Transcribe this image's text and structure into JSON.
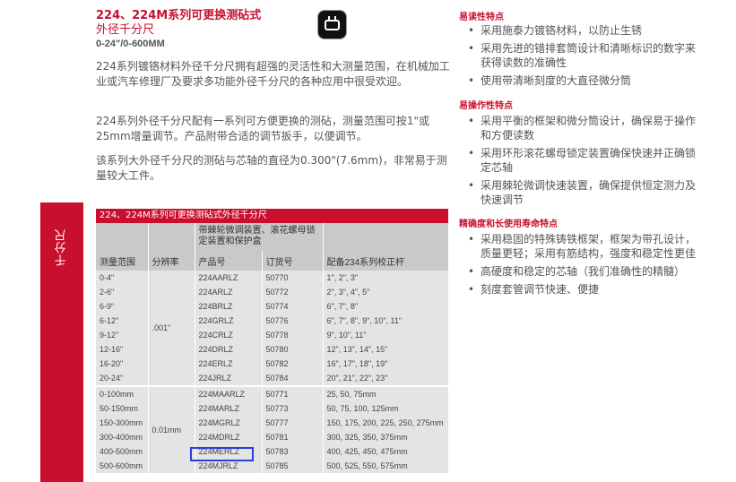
{
  "side_tab": {
    "label": "千分尺"
  },
  "header": {
    "title_line1": "224、224M系列可更换测砧式",
    "title_line2": "外径千分尺",
    "range": "0-24\"/0-600MM"
  },
  "intro": {
    "para1": "224系列镀铬材料外径千分尺拥有超强的灵活性和大测量范围，在机械加工业或汽车修理厂及要求多功能外径千分尺的各种应用中很受欢迎。",
    "para2": "224系列外径千分尺配有一系列可方便更换的测砧，测量范围可按1\"或25mm增量调节。产品附带合适的调节扳手，以便调节。",
    "para3": "该系列大外径千分尺的测砧与芯轴的直径为0.300\"(7.6mm)，非常易于测量较大工件。"
  },
  "table": {
    "caption": "224、224M系列可更换测砧式外径千分尺",
    "group_header": "带棘轮微调装置、滚花螺母锁定装置和保护盒",
    "columns": [
      "测量范围",
      "分辨率",
      "产品号",
      "订货号",
      "配备234系列校正杆"
    ],
    "resolution_inch": ".001\"",
    "resolution_mm": "0.01mm",
    "rows_inch": [
      {
        "range": "0-4\"",
        "product": "224AARLZ",
        "order": "50770",
        "bars": "1\", 2\", 3\""
      },
      {
        "range": "2-6\"",
        "product": "224ARLZ",
        "order": "50772",
        "bars": "2\", 3\", 4\", 5\""
      },
      {
        "range": "6-9\"",
        "product": "224BRLZ",
        "order": "50774",
        "bars": "6\", 7\", 8\""
      },
      {
        "range": "6-12\"",
        "product": "224GRLZ",
        "order": "50776",
        "bars": "6\", 7\", 8\", 9\", 10\", 11\""
      },
      {
        "range": "9-12\"",
        "product": "224CRLZ",
        "order": "50778",
        "bars": "9\", 10\", 11\""
      },
      {
        "range": "12-16\"",
        "product": "224DRLZ",
        "order": "50780",
        "bars": "12\", 13\", 14\", 15\""
      },
      {
        "range": "16-20\"",
        "product": "224ERLZ",
        "order": "50782",
        "bars": "16\", 17\", 18\", 19\""
      },
      {
        "range": "20-24\"",
        "product": "224JRLZ",
        "order": "50784",
        "bars": "20\", 21\", 22\", 23\""
      }
    ],
    "rows_mm": [
      {
        "range": "0-100mm",
        "product": "224MAARLZ",
        "order": "50771",
        "bars": "25, 50, 75mm"
      },
      {
        "range": "50-150mm",
        "product": "224MARLZ",
        "order": "50773",
        "bars": "50, 75, 100, 125mm"
      },
      {
        "range": "150-300mm",
        "product": "224MGRLZ",
        "order": "50777",
        "bars": "150, 175, 200, 225, 250, 275mm"
      },
      {
        "range": "300-400mm",
        "product": "224MDRLZ",
        "order": "50781",
        "bars": "300, 325, 350, 375mm"
      },
      {
        "range": "400-500mm",
        "product": "224MERLZ",
        "order": "50783",
        "bars": "400, 425, 450, 475mm"
      },
      {
        "range": "500-600mm",
        "product": "224MJRLZ",
        "order": "50785",
        "bars": "500, 525, 550, 575mm"
      }
    ]
  },
  "features": {
    "readability_title": "易读性特点",
    "readability": [
      "采用施泰力镀铬材料，以防止生锈",
      "采用先进的错排套筒设计和清晰标识的数字来获得读数的准确性",
      "使用带清晰刻度的大直径微分筒"
    ],
    "operability_title": "易操作性特点",
    "operability": [
      "采用平衡的框架和微分筒设计，确保易于操作和方便读数",
      "采用环形滚花螺母锁定装置确保快速并正确锁定芯轴",
      "采用棘轮微调快速装置，确保提供恒定测力及快速调节"
    ],
    "accuracy_title": "精确度和长使用寿命特点",
    "accuracy": [
      "采用稳固的特殊铸铁框架，框架为带孔设计，质量更轻；采用有筋结构，强度和稳定性更佳",
      "高硬度和稳定的芯轴（我们准确性的精髓）",
      "刻度套管调节快速、便捷"
    ]
  }
}
